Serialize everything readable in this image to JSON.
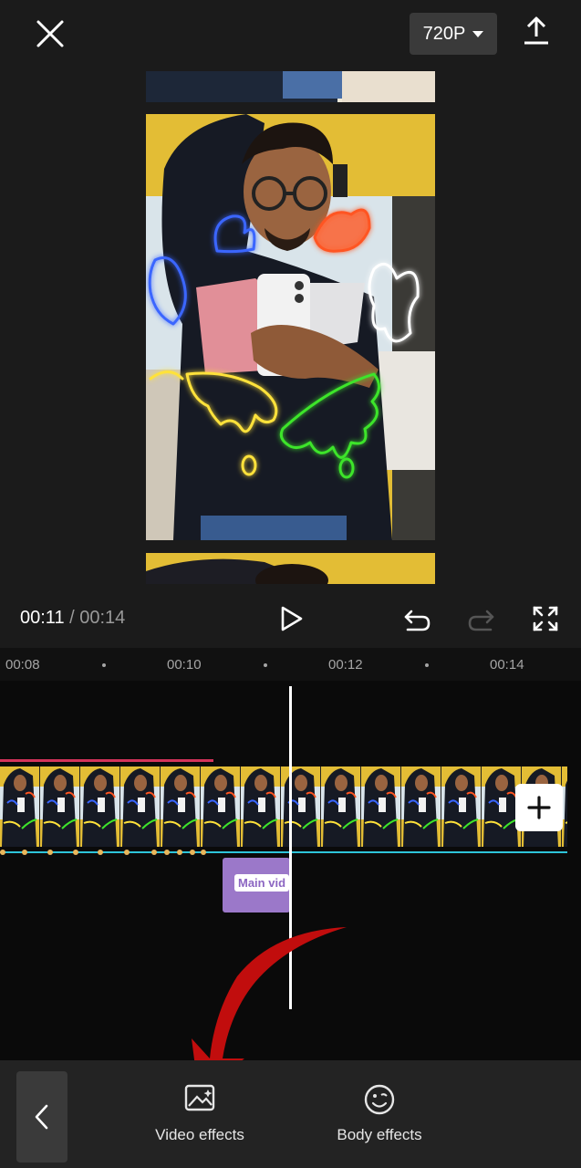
{
  "topbar": {
    "resolution": "720P"
  },
  "playback": {
    "current_time": "00:11",
    "separator": " / ",
    "total_time": "00:14"
  },
  "ruler": {
    "labels": [
      "00:08",
      "00:10",
      "00:12",
      "00:14"
    ]
  },
  "timeline": {
    "main_clip_label": "Main vid"
  },
  "tools": [
    {
      "label": "Video effects",
      "icon": "video-effects-icon"
    },
    {
      "label": "Body effects",
      "icon": "body-effects-icon"
    }
  ],
  "colors": {
    "background": "#1c1c1c",
    "timeline_bg": "#0a0a0a",
    "playhead": "#ffffff",
    "audio_line": "#d4335a",
    "cyan_line": "#2ec4d9",
    "main_tag": "#9b78c9",
    "annotation_arrow": "#c10d0d"
  }
}
